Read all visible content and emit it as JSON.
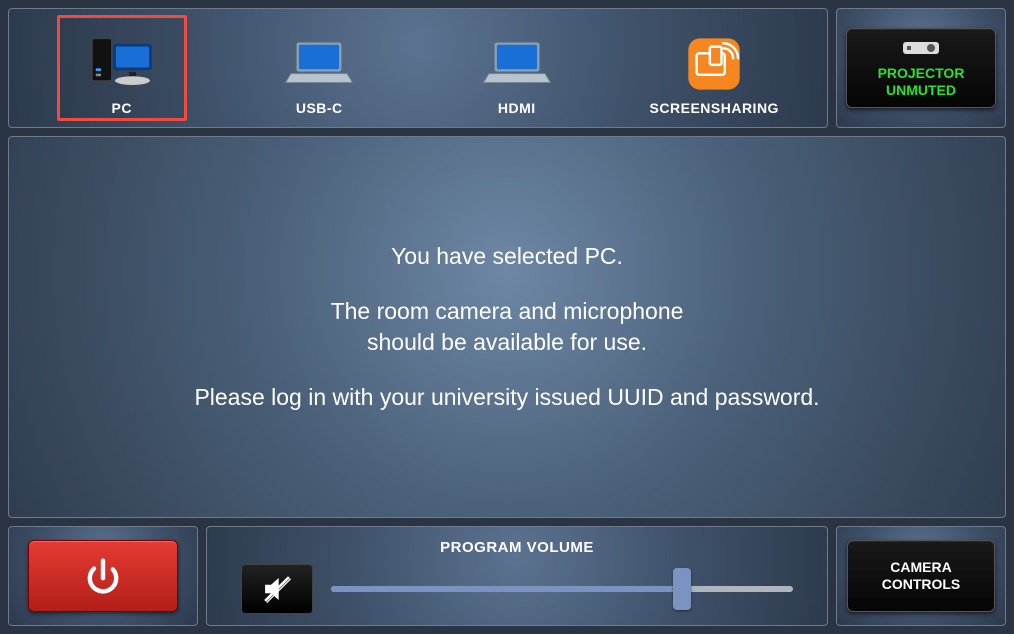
{
  "sources": {
    "items": [
      {
        "id": "pc",
        "label": "PC",
        "icon": "pc-icon",
        "selected": true
      },
      {
        "id": "usbc",
        "label": "USB-C",
        "icon": "laptop-icon",
        "selected": false
      },
      {
        "id": "hdmi",
        "label": "HDMI",
        "icon": "laptop-icon",
        "selected": false
      },
      {
        "id": "share",
        "label": "SCREENSHARING",
        "icon": "screenshare-icon",
        "selected": false
      }
    ]
  },
  "projector": {
    "status_line1": "PROJECTOR",
    "status_line2": "UNMUTED"
  },
  "info": {
    "line1": "You have selected PC.",
    "line2": "The room camera and microphone",
    "line3": "should be available for use.",
    "line4": "Please log in with your university issued UUID and password."
  },
  "volume": {
    "title": "PROGRAM VOLUME",
    "value_percent": 76
  },
  "camera": {
    "label_line1": "CAMERA",
    "label_line2": "CONTROLS"
  }
}
